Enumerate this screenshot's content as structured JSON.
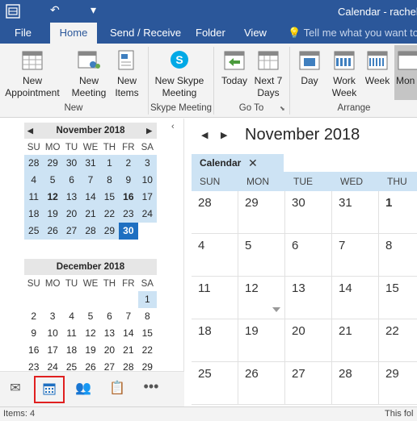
{
  "window": {
    "title": "Calendar - rachel.a"
  },
  "tabs": [
    {
      "label": "File"
    },
    {
      "label": "Home"
    },
    {
      "label": "Send / Receive"
    },
    {
      "label": "Folder"
    },
    {
      "label": "View"
    }
  ],
  "tell_me": "Tell me what you want to d",
  "ribbon": {
    "new_appointment": "New Appointment",
    "new_meeting": "New Meeting",
    "new_items": "New Items",
    "group_new": "New",
    "new_skype_meeting": "New Skype Meeting",
    "group_skype": "Skype Meeting",
    "today": "Today",
    "next_7_days": "Next 7 Days",
    "group_goto": "Go To",
    "day": "Day",
    "work_week": "Work Week",
    "week": "Week",
    "month": "Mon",
    "group_arrange": "Arrange"
  },
  "minical": {
    "dow": [
      "SU",
      "MO",
      "TU",
      "WE",
      "TH",
      "FR",
      "SA"
    ],
    "november": {
      "title": "November 2018",
      "weeks": [
        [
          "28",
          "29",
          "30",
          "31",
          "1",
          "2",
          "3"
        ],
        [
          "4",
          "5",
          "6",
          "7",
          "8",
          "9",
          "10"
        ],
        [
          "11",
          "12",
          "13",
          "14",
          "15",
          "16",
          "17"
        ],
        [
          "18",
          "19",
          "20",
          "21",
          "22",
          "23",
          "24"
        ],
        [
          "25",
          "26",
          "27",
          "28",
          "29",
          "30",
          ""
        ]
      ]
    },
    "december": {
      "title": "December 2018",
      "weeks": [
        [
          "",
          "",
          "",
          "",
          "",
          "",
          "1"
        ],
        [
          "2",
          "3",
          "4",
          "5",
          "6",
          "7",
          "8"
        ],
        [
          "9",
          "10",
          "11",
          "12",
          "13",
          "14",
          "15"
        ],
        [
          "16",
          "17",
          "18",
          "19",
          "20",
          "21",
          "22"
        ],
        [
          "23",
          "24",
          "25",
          "26",
          "27",
          "28",
          "29"
        ]
      ]
    }
  },
  "main": {
    "month_title": "November 2018",
    "calendar_tab": "Calendar",
    "dow": [
      "SUN",
      "MON",
      "TUE",
      "WED",
      "THU"
    ],
    "weeks": [
      [
        "28",
        "29",
        "30",
        "31",
        "1"
      ],
      [
        "4",
        "5",
        "6",
        "7",
        "8"
      ],
      [
        "11",
        "12",
        "13",
        "14",
        "15"
      ],
      [
        "18",
        "19",
        "20",
        "21",
        "22"
      ],
      [
        "25",
        "26",
        "27",
        "28",
        "29"
      ]
    ]
  },
  "status": {
    "items": "Items: 4",
    "right": "This fol"
  },
  "colors": {
    "brand": "#2b579a",
    "selection": "#cde3f4",
    "today": "#1e6fc1"
  }
}
